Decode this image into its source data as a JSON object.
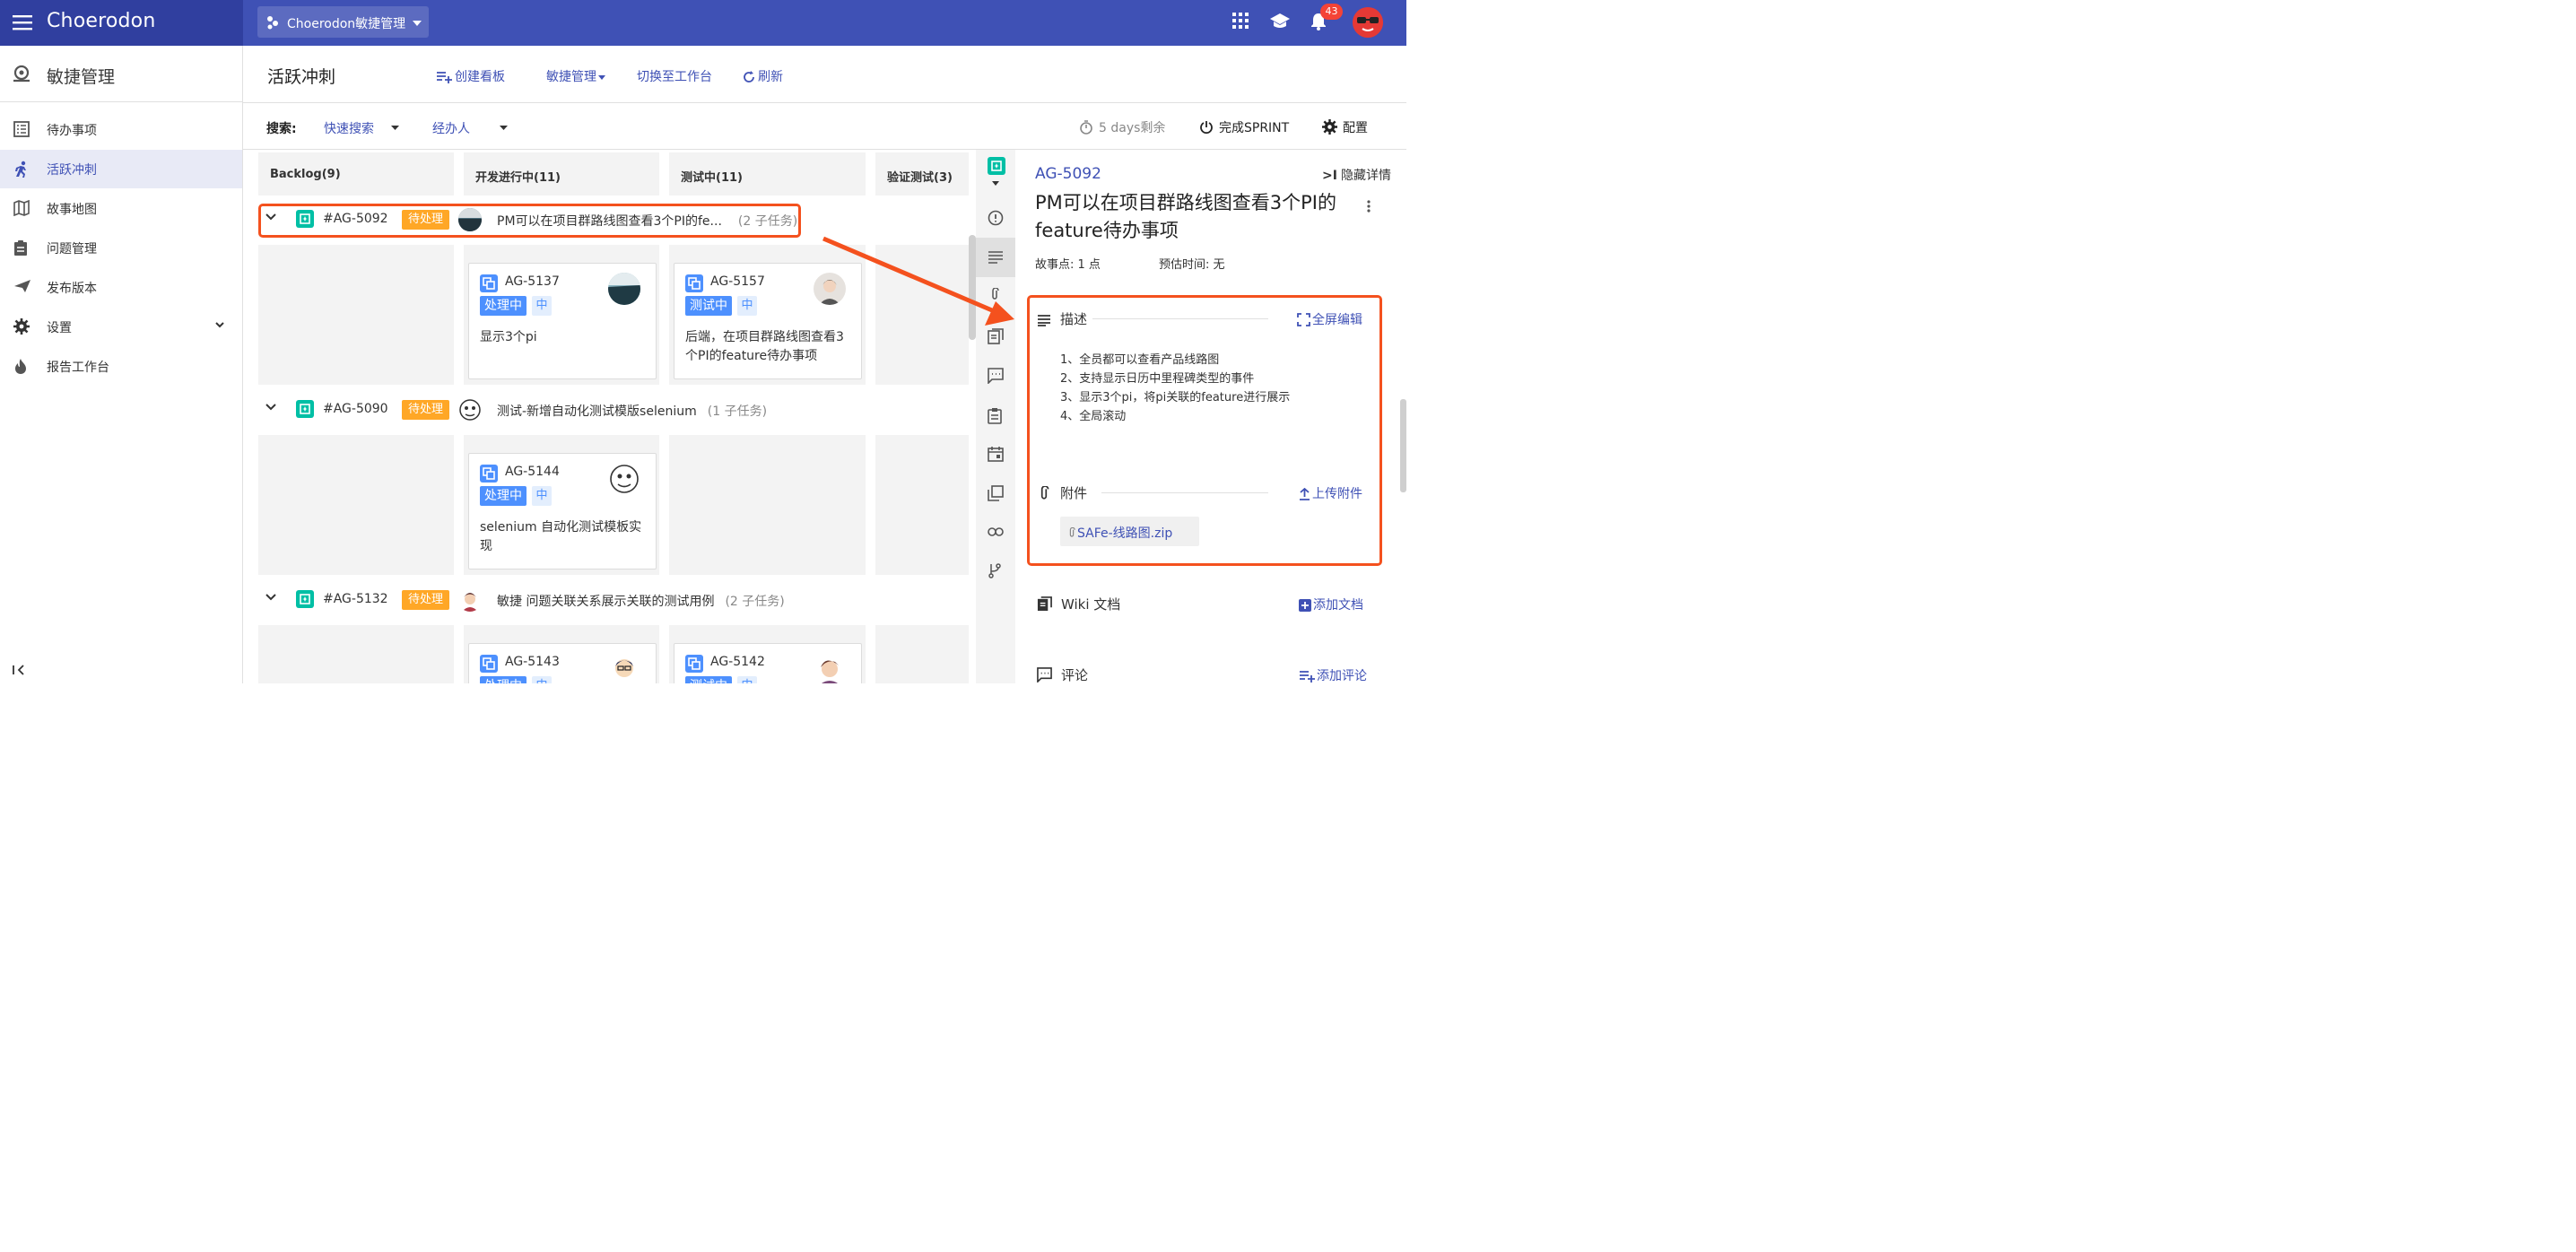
{
  "topbar": {
    "brand": "Choerodon",
    "project": "Choerodon敏捷管理",
    "notification_count": "43",
    "colors": {
      "bar": "#3f51b5",
      "left": "#303f9f"
    }
  },
  "sidebar": {
    "title": "敏捷管理",
    "items": [
      {
        "label": "待办事项",
        "icon": "list-icon"
      },
      {
        "label": "活跃冲刺",
        "icon": "run-icon",
        "active": true
      },
      {
        "label": "故事地图",
        "icon": "map-icon"
      },
      {
        "label": "问题管理",
        "icon": "clipboard-icon"
      },
      {
        "label": "发布版本",
        "icon": "send-icon"
      },
      {
        "label": "设置",
        "icon": "gear-icon"
      },
      {
        "label": "报告工作台",
        "icon": "fire-icon"
      }
    ]
  },
  "header": {
    "title": "活跃冲刺",
    "create_board": "创建看板",
    "agile_menu": "敏捷管理",
    "switch_workbench": "切换至工作台",
    "refresh": "刷新"
  },
  "filter": {
    "label": "搜索:",
    "quick_search": "快速搜索",
    "assignee": "经办人",
    "remaining": "5 days剩余",
    "complete_sprint": "完成SPRINT",
    "config": "配置"
  },
  "board": {
    "columns": [
      "Backlog(9)",
      "开发进行中(11)",
      "测试中(11)",
      "验证测试(3)"
    ],
    "swimlanes": [
      {
        "key": "#AG-5092",
        "status": "待处理",
        "summary": "PM可以在项目群路线图查看3个PI的fe...",
        "count": "(2 子任务)",
        "cards": [
          {
            "key": "AG-5137",
            "status": "处理中",
            "priority": "中",
            "summary": "显示3个pi"
          },
          {
            "key": "AG-5157",
            "status": "测试中",
            "priority": "中",
            "summary": "后端，在项目群路线图查看3个PI的feature待办事项"
          }
        ]
      },
      {
        "key": "#AG-5090",
        "status": "待处理",
        "summary": "测试-新增自动化测试模版selenium",
        "count": "(1 子任务)",
        "cards": [
          {
            "key": "AG-5144",
            "status": "处理中",
            "priority": "中",
            "summary": "selenium 自动化测试模板实现"
          }
        ]
      },
      {
        "key": "#AG-5132",
        "status": "待处理",
        "summary": "敏捷 问题关联关系展示关联的测试用例",
        "count": "(2 子任务)",
        "cards": [
          {
            "key": "AG-5143",
            "status": "处理中",
            "priority": "中",
            "summary": ""
          },
          {
            "key": "AG-5142",
            "status": "测试中",
            "priority": "中",
            "summary": ""
          }
        ]
      }
    ]
  },
  "detail": {
    "key": "AG-5092",
    "hide": "隐藏详情",
    "title": "PM可以在项目群路线图查看3个PI的feature待办事项",
    "story_points": "故事点:  1 点",
    "estimate": "预估时间:  无",
    "description_label": "描述",
    "fullscreen_edit": "全屏编辑",
    "description_lines": [
      "1、全员都可以查看产品线路图",
      "2、支持显示日历中里程碑类型的事件",
      "3、显示3个pi，将pi关联的feature进行展示",
      "4、全局滚动"
    ],
    "attachment_label": "附件",
    "upload": "上传附件",
    "attachment_file": "SAFe-线路图.zip",
    "wiki_label": "Wiki 文档",
    "add_doc": "添加文档",
    "comment_label": "评论",
    "add_comment": "添加评论"
  },
  "colors": {
    "accent": "#3f51b5",
    "pending": "#ffa726",
    "status_blue": "#4d90fe",
    "story_green": "#00bfa5",
    "highlight": "#f4511e"
  }
}
